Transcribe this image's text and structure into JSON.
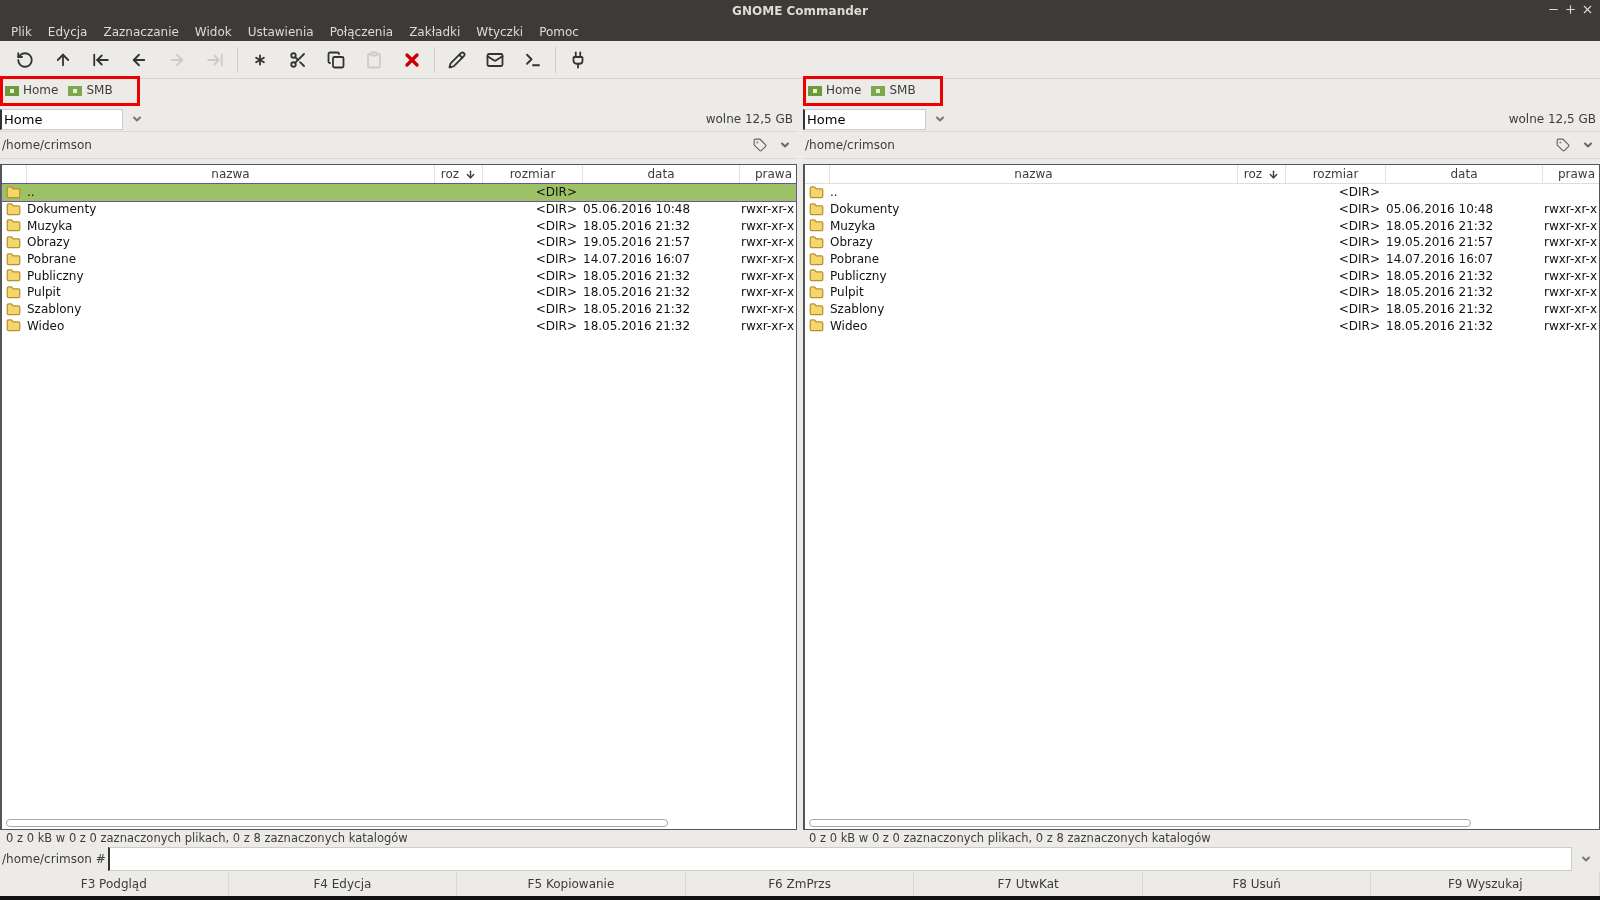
{
  "window": {
    "title": "GNOME Commander"
  },
  "menu": [
    "Plik",
    "Edycja",
    "Zaznaczanie",
    "Widok",
    "Ustawienia",
    "Połączenia",
    "Zakładki",
    "Wtyczki",
    "Pomoc"
  ],
  "toolbar": [
    {
      "kind": "refresh",
      "disabled": false
    },
    {
      "kind": "up",
      "disabled": false
    },
    {
      "kind": "first",
      "disabled": false
    },
    {
      "kind": "back",
      "disabled": false
    },
    {
      "kind": "forward",
      "disabled": true
    },
    {
      "kind": "last",
      "disabled": true
    },
    {
      "kind": "separator"
    },
    {
      "kind": "pattern",
      "disabled": false
    },
    {
      "kind": "cut",
      "disabled": false
    },
    {
      "kind": "copy",
      "disabled": false
    },
    {
      "kind": "paste",
      "disabled": true
    },
    {
      "kind": "delete",
      "disabled": false
    },
    {
      "kind": "separator"
    },
    {
      "kind": "edit",
      "disabled": false
    },
    {
      "kind": "mail",
      "disabled": false
    },
    {
      "kind": "terminal",
      "disabled": false
    },
    {
      "kind": "separator"
    },
    {
      "kind": "connect",
      "disabled": false
    }
  ],
  "panels": [
    {
      "devices": [
        {
          "label": "Home",
          "kind": "home"
        },
        {
          "label": "SMB",
          "kind": "smb"
        }
      ],
      "drive": "Home",
      "free": "wolne 12,5 GB",
      "path": "/home/crimson",
      "columns": [
        "nazwa",
        "roz",
        "rozmiar",
        "data",
        "prawa"
      ],
      "rows": [
        {
          "name": "..",
          "ext": "",
          "size": "<DIR>",
          "date": "",
          "perms": "",
          "selected": true
        },
        {
          "name": "Dokumenty",
          "ext": "",
          "size": "<DIR>",
          "date": "05.06.2016 10:48",
          "perms": "rwxr-xr-x",
          "selected": false
        },
        {
          "name": "Muzyka",
          "ext": "",
          "size": "<DIR>",
          "date": "18.05.2016 21:32",
          "perms": "rwxr-xr-x",
          "selected": false
        },
        {
          "name": "Obrazy",
          "ext": "",
          "size": "<DIR>",
          "date": "19.05.2016 21:57",
          "perms": "rwxr-xr-x",
          "selected": false
        },
        {
          "name": "Pobrane",
          "ext": "",
          "size": "<DIR>",
          "date": "14.07.2016 16:07",
          "perms": "rwxr-xr-x",
          "selected": false
        },
        {
          "name": "Publiczny",
          "ext": "",
          "size": "<DIR>",
          "date": "18.05.2016 21:32",
          "perms": "rwxr-xr-x",
          "selected": false
        },
        {
          "name": "Pulpit",
          "ext": "",
          "size": "<DIR>",
          "date": "18.05.2016 21:32",
          "perms": "rwxr-xr-x",
          "selected": false
        },
        {
          "name": "Szablony",
          "ext": "",
          "size": "<DIR>",
          "date": "18.05.2016 21:32",
          "perms": "rwxr-xr-x",
          "selected": false
        },
        {
          "name": "Wideo",
          "ext": "",
          "size": "<DIR>",
          "date": "18.05.2016 21:32",
          "perms": "rwxr-xr-x",
          "selected": false
        }
      ],
      "status": "0  z 0  kB w 0 z 0 zaznaczonych plikach, 0 z 8 zaznaczonych katalogów"
    },
    {
      "devices": [
        {
          "label": "Home",
          "kind": "home"
        },
        {
          "label": "SMB",
          "kind": "smb"
        }
      ],
      "drive": "Home",
      "free": "wolne 12,5 GB",
      "path": "/home/crimson",
      "columns": [
        "nazwa",
        "roz",
        "rozmiar",
        "data",
        "prawa"
      ],
      "rows": [
        {
          "name": "..",
          "ext": "",
          "size": "<DIR>",
          "date": "",
          "perms": "",
          "selected": false
        },
        {
          "name": "Dokumenty",
          "ext": "",
          "size": "<DIR>",
          "date": "05.06.2016 10:48",
          "perms": "rwxr-xr-x",
          "selected": false
        },
        {
          "name": "Muzyka",
          "ext": "",
          "size": "<DIR>",
          "date": "18.05.2016 21:32",
          "perms": "rwxr-xr-x",
          "selected": false
        },
        {
          "name": "Obrazy",
          "ext": "",
          "size": "<DIR>",
          "date": "19.05.2016 21:57",
          "perms": "rwxr-xr-x",
          "selected": false
        },
        {
          "name": "Pobrane",
          "ext": "",
          "size": "<DIR>",
          "date": "14.07.2016 16:07",
          "perms": "rwxr-xr-x",
          "selected": false
        },
        {
          "name": "Publiczny",
          "ext": "",
          "size": "<DIR>",
          "date": "18.05.2016 21:32",
          "perms": "rwxr-xr-x",
          "selected": false
        },
        {
          "name": "Pulpit",
          "ext": "",
          "size": "<DIR>",
          "date": "18.05.2016 21:32",
          "perms": "rwxr-xr-x",
          "selected": false
        },
        {
          "name": "Szablony",
          "ext": "",
          "size": "<DIR>",
          "date": "18.05.2016 21:32",
          "perms": "rwxr-xr-x",
          "selected": false
        },
        {
          "name": "Wideo",
          "ext": "",
          "size": "<DIR>",
          "date": "18.05.2016 21:32",
          "perms": "rwxr-xr-x",
          "selected": false
        }
      ],
      "status": "0  z 0  kB w 0 z 0 zaznaczonych plikach, 0 z 8 zaznaczonych katalogów"
    }
  ],
  "command_line": {
    "prompt": "/home/crimson #"
  },
  "function_keys": [
    "F3 Podgląd",
    "F4 Edycja",
    "F5 Kopiowanie",
    "F6 ZmPrzs",
    "F7 UtwKat",
    "F8 Usuń",
    "F9 Wyszukaj"
  ]
}
